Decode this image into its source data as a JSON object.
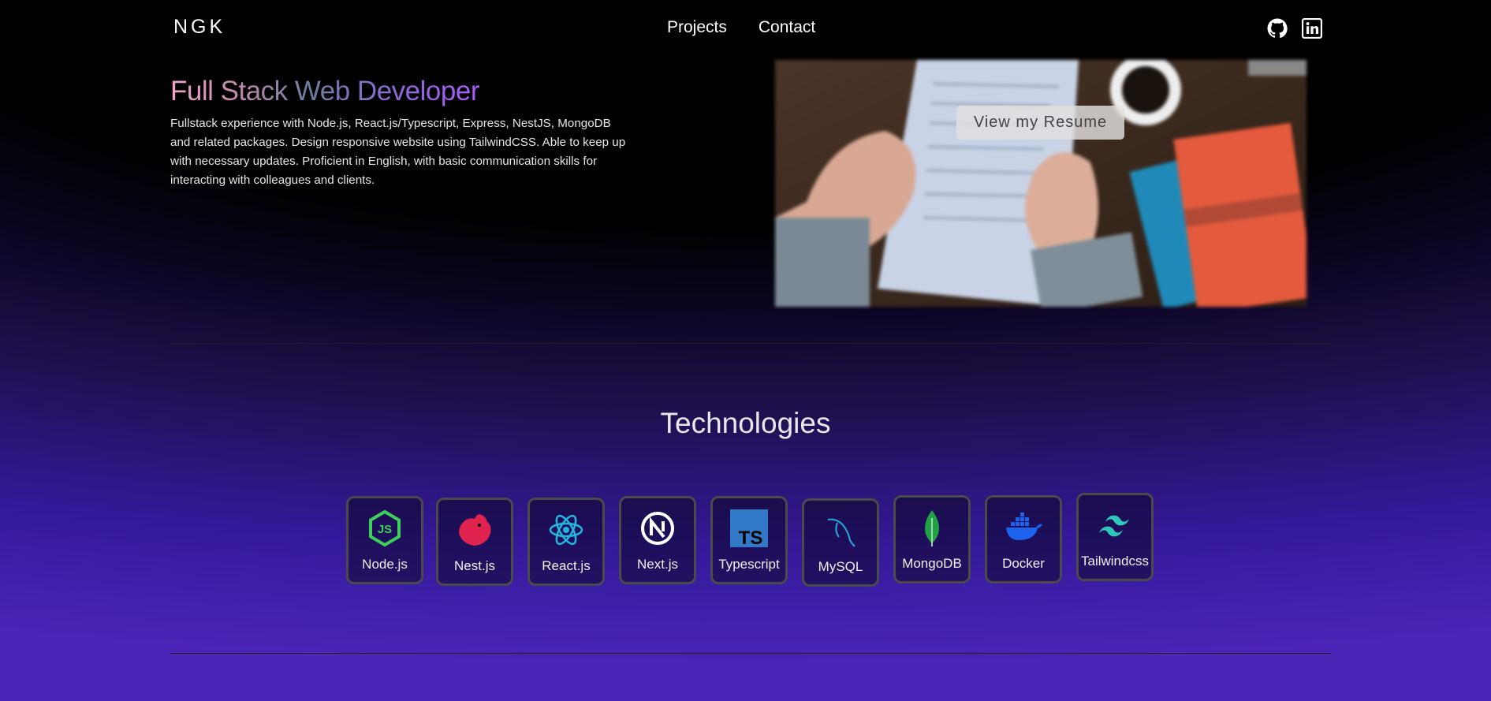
{
  "header": {
    "logo": "NGK",
    "nav": [
      "Projects",
      "Contact"
    ],
    "social": [
      "github-icon",
      "linkedin-icon"
    ]
  },
  "hero": {
    "title": "Full Stack Web Developer",
    "description": "Fullstack experience with Node.js, React.js/Typescript, Express, NestJS, MongoDB and related packages. Design responsive website using TailwindCSS. Able to keep up with necessary updates. Proficient in English, with basic communication skills for interacting with colleagues and clients.",
    "resume_button": "View my Resume"
  },
  "technologies": {
    "title": "Technologies",
    "items": [
      {
        "label": "Node.js",
        "icon": "nodejs-icon",
        "color": "#3ecf5a"
      },
      {
        "label": "Nest.js",
        "icon": "nestjs-icon",
        "color": "#e0234e"
      },
      {
        "label": "React.js",
        "icon": "react-icon",
        "color": "#22b8e0"
      },
      {
        "label": "Next.js",
        "icon": "nextjs-icon",
        "color": "#ffffff"
      },
      {
        "label": "Typescript",
        "icon": "typescript-icon",
        "color": "#3178c6"
      },
      {
        "label": "MySQL",
        "icon": "mysql-icon",
        "color": "#2a9fd6"
      },
      {
        "label": "MongoDB",
        "icon": "mongodb-icon",
        "color": "#21a045"
      },
      {
        "label": "Docker",
        "icon": "docker-icon",
        "color": "#1d63ed"
      },
      {
        "label": "Tailwindcss",
        "icon": "tailwind-icon",
        "color": "#2fc7b8"
      }
    ]
  }
}
